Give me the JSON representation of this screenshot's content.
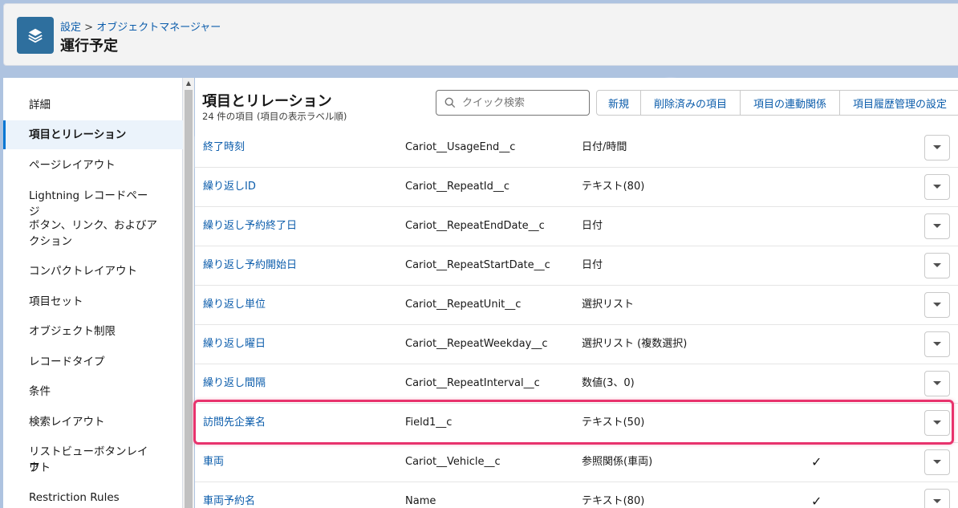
{
  "header": {
    "breadcrumb_setup": "設定",
    "breadcrumb_sep": ">",
    "breadcrumb_object_manager": "オブジェクトマネージャー",
    "title": "運行予定",
    "icon": "layers-icon"
  },
  "sidebar": {
    "items": [
      {
        "label": "詳細"
      },
      {
        "label": "項目とリレーション"
      },
      {
        "label": "ページレイアウト"
      },
      {
        "label": "Lightning レコードページ"
      },
      {
        "label": "ボタン、リンク、およびア"
      },
      {
        "label": "クション"
      },
      {
        "label": "コンパクトレイアウト"
      },
      {
        "label": "項目セット"
      },
      {
        "label": "オブジェクト制限"
      },
      {
        "label": "レコードタイプ"
      },
      {
        "label": "条件"
      },
      {
        "label": "検索レイアウト"
      },
      {
        "label": "リストビューボタンレイア"
      },
      {
        "label": "ウト"
      },
      {
        "label": "Restriction Rules"
      }
    ]
  },
  "main": {
    "title": "項目とリレーション",
    "subtitle": "24 件の項目 (項目の表示ラベル順)",
    "search_placeholder": "クイック検索",
    "buttons": {
      "new": "新規",
      "deleted": "削除済みの項目",
      "dependencies": "項目の連動関係",
      "history": "項目履歴管理の設定"
    },
    "rows": [
      {
        "label": "終了時刻",
        "api": "Cariot__UsageEnd__c",
        "type": "日付/時間",
        "check": ""
      },
      {
        "label": "繰り返しID",
        "api": "Cariot__RepeatId__c",
        "type": "テキスト(80)",
        "check": ""
      },
      {
        "label": "繰り返し予約終了日",
        "api": "Cariot__RepeatEndDate__c",
        "type": "日付",
        "check": ""
      },
      {
        "label": "繰り返し予約開始日",
        "api": "Cariot__RepeatStartDate__c",
        "type": "日付",
        "check": ""
      },
      {
        "label": "繰り返し単位",
        "api": "Cariot__RepeatUnit__c",
        "type": "選択リスト",
        "check": ""
      },
      {
        "label": "繰り返し曜日",
        "api": "Cariot__RepeatWeekday__c",
        "type": "選択リスト (複数選択)",
        "check": ""
      },
      {
        "label": "繰り返し間隔",
        "api": "Cariot__RepeatInterval__c",
        "type": "数値(3、0)",
        "check": ""
      },
      {
        "label": "訪問先企業名",
        "api": "Field1__c",
        "type": "テキスト(50)",
        "check": ""
      },
      {
        "label": "車両",
        "api": "Cariot__Vehicle__c",
        "type": "参照関係(車両)",
        "check": "✓"
      },
      {
        "label": "車両予約名",
        "api": "Name",
        "type": "テキスト(80)",
        "check": "✓"
      }
    ]
  },
  "colors": {
    "link": "#0b5cab",
    "highlight": "#e8336d",
    "header_icon": "#2e6f9e",
    "active_nav": "#ebf3fb"
  }
}
